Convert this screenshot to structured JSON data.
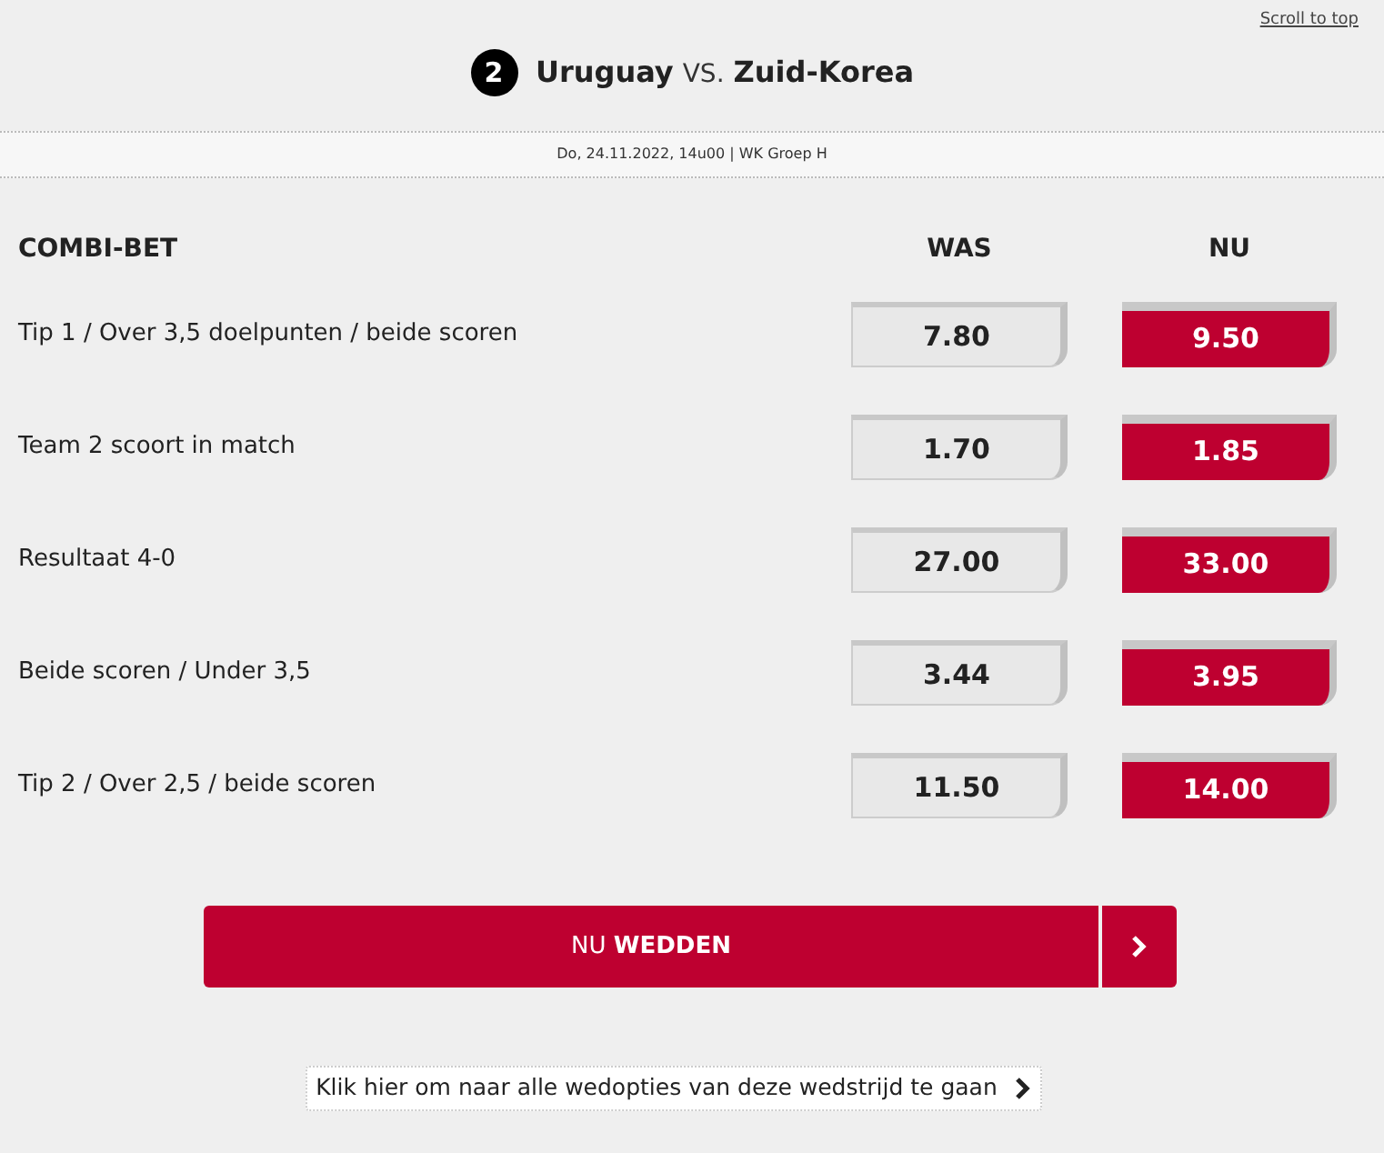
{
  "scroll_link": "Scroll to top",
  "match": {
    "number": "2",
    "team_1": "Uruguay",
    "vs": "VS.",
    "team_2": "Zuid-Korea",
    "info": "Do, 24.11.2022, 14u00 | WK Groep H"
  },
  "table": {
    "columns": [
      "COMBI-BET",
      "WAS",
      "NU"
    ],
    "rows": [
      {
        "bet": "Tip 1 / Over 3,5 doelpunten / beide scoren",
        "was": "7.80",
        "nu": "9.50"
      },
      {
        "bet": "Team 2 scoort in match",
        "was": "1.70",
        "nu": "1.85"
      },
      {
        "bet": "Resultaat 4-0",
        "was": "27.00",
        "nu": "33.00"
      },
      {
        "bet": "Beide scoren / Under 3,5",
        "was": "3.44",
        "nu": "3.95"
      },
      {
        "bet": "Tip 2 / Over 2,5 / beide scoren",
        "was": "11.50",
        "nu": "14.00"
      }
    ]
  },
  "bet_button": "NU **WEDDEN**",
  "all_options_link": "Klik hier om naar alle wedopties van deze wedstrijd te gaan"
}
